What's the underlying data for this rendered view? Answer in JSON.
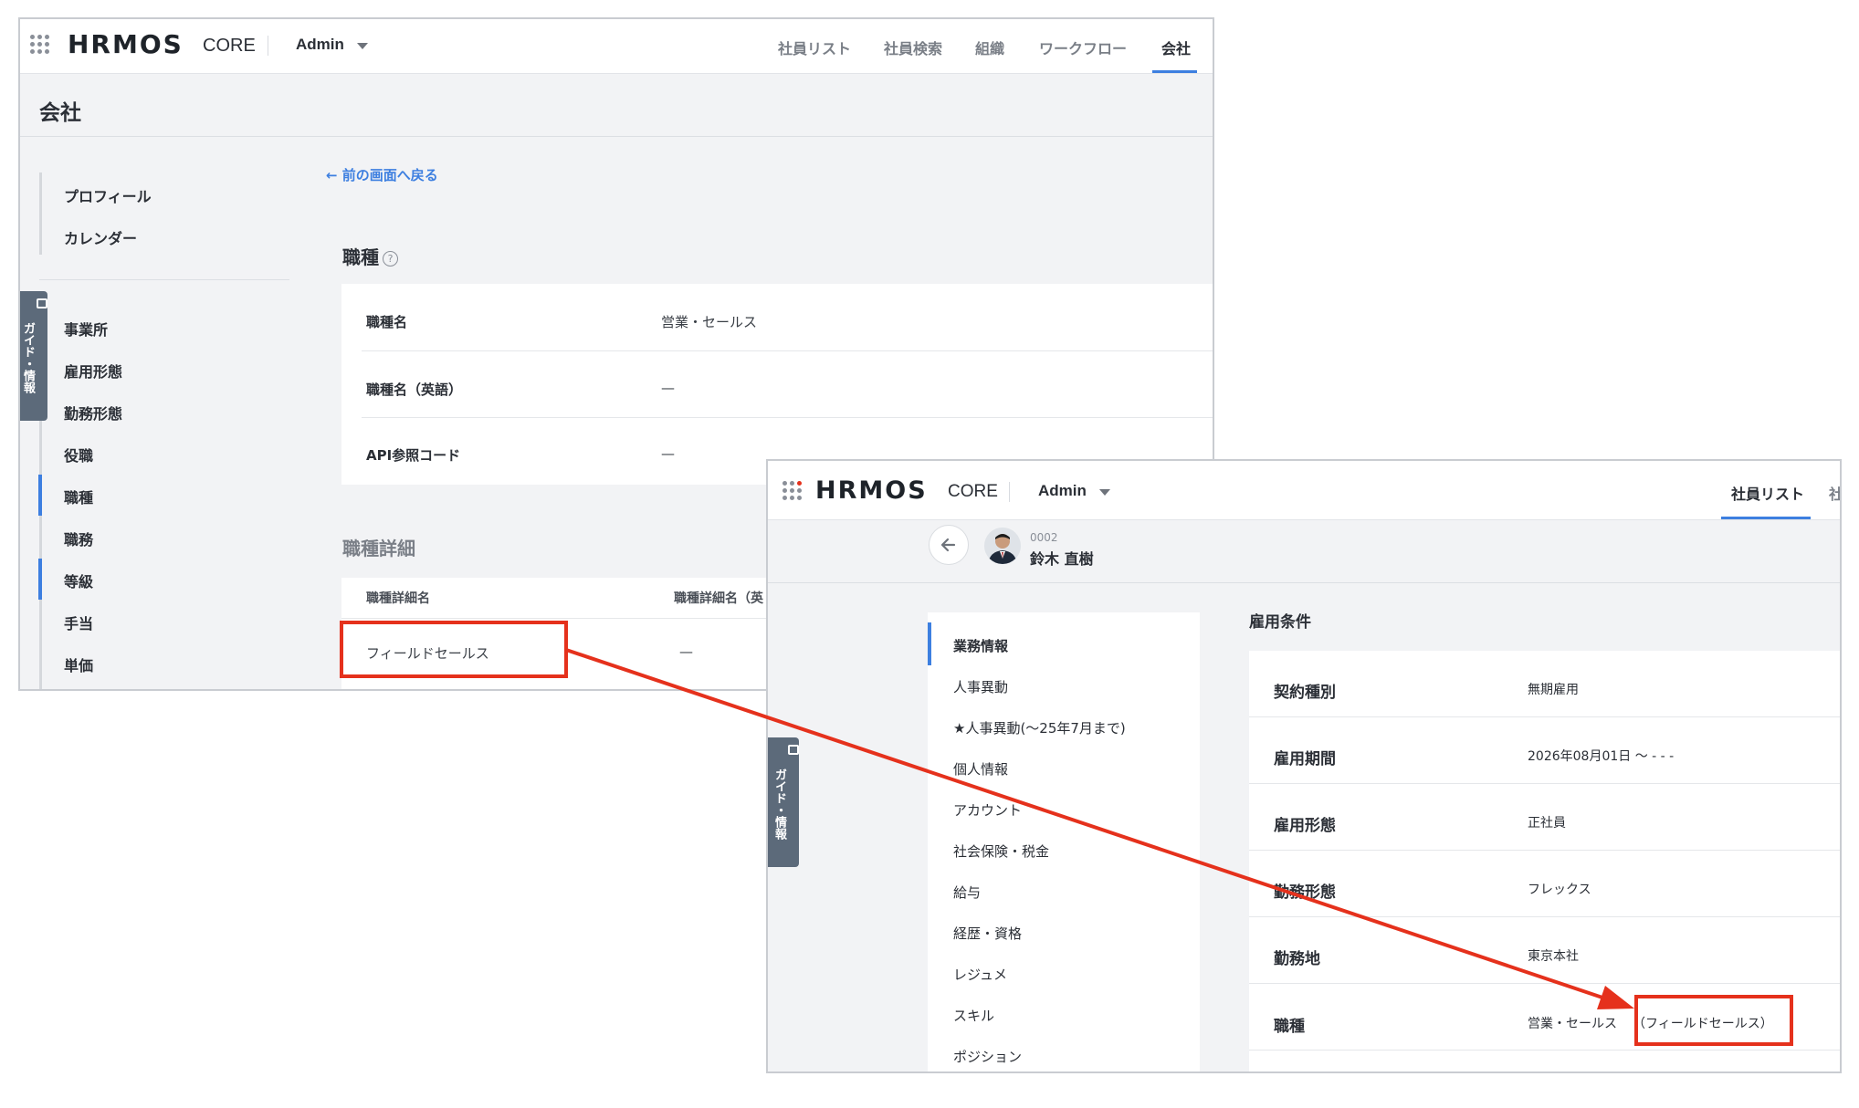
{
  "window1": {
    "logo": "HRMOS",
    "logo_sub": "CORE",
    "admin_label": "Admin",
    "nav": [
      "社員リスト",
      "社員検索",
      "組織",
      "ワークフロー",
      "会社"
    ],
    "page_title": "会社",
    "sidebar_top": [
      "プロフィール",
      "カレンダー"
    ],
    "sidebar_items": [
      "事業所",
      "雇用形態",
      "勤務形態",
      "役職",
      "職種",
      "職務",
      "等級",
      "手当",
      "単価"
    ],
    "guide_tab": "ガイド・情報",
    "back_link": "← 前の画面へ戻る",
    "section_title": "職種",
    "fields": [
      {
        "label": "職種名",
        "value": "営業・セールス"
      },
      {
        "label": "職種名（英語）",
        "value": "—"
      },
      {
        "label": "API参照コード",
        "value": "—"
      }
    ],
    "detail_title": "職種詳細",
    "detail_headers": [
      "職種詳細名",
      "職種詳細名（英"
    ],
    "detail_row": {
      "name": "フィールドセールス",
      "name_en": "—"
    }
  },
  "window2": {
    "logo": "HRMOS",
    "logo_sub": "CORE",
    "admin_label": "Admin",
    "nav_active": "社員リスト",
    "nav_partial": "社",
    "employee": {
      "number": "0002",
      "name": "鈴木 直樹"
    },
    "guide_tab": "ガイド・情報",
    "menu": [
      "業務情報",
      "人事異動",
      "★人事異動(〜25年7月まで)",
      "個人情報",
      "アカウント",
      "社会保険・税金",
      "給与",
      "経歴・資格",
      "レジュメ",
      "スキル",
      "ポジション"
    ],
    "section_title": "雇用条件",
    "fields": [
      {
        "label": "契約種別",
        "value": "無期雇用"
      },
      {
        "label": "雇用期間",
        "value": "2026年08月01日 〜 - - -"
      },
      {
        "label": "雇用形態",
        "value": "正社員"
      },
      {
        "label": "勤務形態",
        "value": "フレックス"
      },
      {
        "label": "勤務地",
        "value": "東京本社"
      },
      {
        "label": "職種",
        "value": "営業・セールス",
        "value_detail": "（フィールドセールス）"
      }
    ]
  },
  "colors": {
    "accent": "#3d7fe0",
    "highlight": "#e5311c",
    "logo_dot": "#e5311c"
  }
}
